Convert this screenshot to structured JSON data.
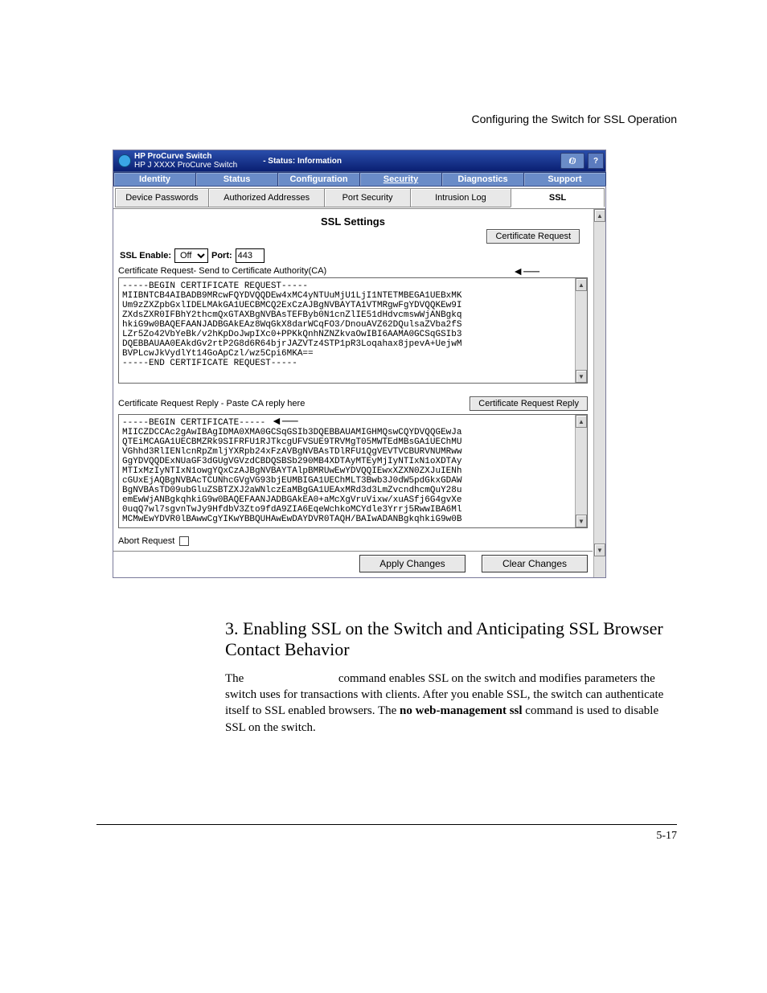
{
  "header_line": "Configuring the Switch for SSL Operation",
  "titlebar": {
    "line1": "HP ProCurve Switch",
    "line2": "HP J XXXX ProCurve Switch",
    "status": "- Status: Information",
    "help": "?"
  },
  "primary_tabs": [
    "Identity",
    "Status",
    "Configuration",
    "Security",
    "Diagnostics",
    "Support"
  ],
  "secondary_tabs": [
    "Device Passwords",
    "Authorized Addresses",
    "Port Security",
    "Intrusion Log",
    "SSL"
  ],
  "ssl": {
    "title": "SSL Settings",
    "cert_request_btn": "Certificate Request",
    "enable_label": "SSL Enable:",
    "enable_value": "Off",
    "port_label": "Port:",
    "port_value": "443",
    "ca_caption": "Certificate Request- Send to Certificate Authority(CA)",
    "request_text": "-----BEGIN CERTIFICATE REQUEST-----\nMIIBNTCB4AIBADB9MRcwFQYDVQQDEw4xMC4yNTUuMjU1LjI1NTETMBEGA1UEBxMK\nUm9zZXZpbGxlIDELMAkGA1UECBMCQ2ExCzAJBgNVBAYTA1VTMRgwFgYDVQQKEw9I\nZXdsZXR0IFBhY2thcmQxGTAXBgNVBAsTEFByb0N1cnZlIE51dHdvcmswWjANBgkq\nhkiG9w0BAQEFAANJADBGAkEAz8WqGkX8darWCqFO3/DnouAVZ62DQulsaZVba2fS\nLZr5Zo42VbYeBk/v2hKpDoJwpIXc0+PPKkQnhNZNZkvaOwIBI6AAMA0GCSqGSIb3\nDQEBBAUAA0EAkdGv2rtP2G8d6R64bjrJAZVTz4STP1pR3Loqahax8jpevA+UejwM\nBVPLcwJkVydlYt14GoApCzl/wz5Cpi6MKA==\n-----END CERTIFICATE REQUEST-----",
    "reply_caption": "Certificate Request Reply - Paste CA reply here",
    "reply_btn": "Certificate Request Reply",
    "reply_text": "-----BEGIN CERTIFICATE-----\nMIICZDCCAc2gAwIBAgIDMA0XMA0GCSqGSIb3DQEBBAUAMIGHMQswCQYDVQQGEwJa\nQTEiMCAGA1UECBMZRk9SIFRFU1RJTkcgUFVSUE9TRVMgT05MWTEdMBsGA1UEChMU\nVGhhd3RlIENlcnRpZmljYXRpb24xFzAVBgNVBAsTDlRFU1QgVEVTVCBURVNUMRww\nGgYDVQQDExNUaGF3dGUgVGVzdCBDQSBSb290MB4XDTAyMTEyMjIyNTIxN1oXDTAy\nMTIxMzIyNTIxN1owgYQxCzAJBgNVBAYTAlpBMRUwEwYDVQQIEwxXZXN0ZXJuIENh\ncGUxEjAQBgNVBAcTCUNhcGVgVG93bjEUMBIGA1UEChMLT3Bwb3J0dW5pdGkxGDAW\nBgNVBAsTD09ubGluZSBTZXJ2aWNlczEaMBgGA1UEAxMRd3d3LmZvcndhcmQuY28u\nemEwWjANBgkqhkiG9w0BAQEFAANJADBGAkEA0+aMcXgVruVixw/xuASfj6G4gvXe\n0uqQ7wl7sgvnTwJy9HfdbV3Zto9fdA9ZIA6EqeWchkoMCYdle3Yrrj5RwwIBA6Ml\nMCMwEwYDVR0lBAwwCgYIKwYBBQUHAwEwDAYDVR0TAQH/BAIwADANBgkqhkiG9w0B",
    "abort_label": "Abort Request"
  },
  "footer": {
    "apply": "Apply Changes",
    "clear": "Clear Changes"
  },
  "arrow_marker": "◄──",
  "heading": "3.  Enabling SSL on the Switch and Anticipating SSL Browser Contact Behavior",
  "paragraph_pre": "The ",
  "paragraph_mid": " command enables SSL on the switch and modifies parameters the switch uses for transactions with clients. After you enable SSL, the switch can authenticate itself to SSL enabled browsers. The ",
  "paragraph_bold": "no web-management ssl",
  "paragraph_post": " command is used to disable SSL on the switch.",
  "page_number": "5-17"
}
